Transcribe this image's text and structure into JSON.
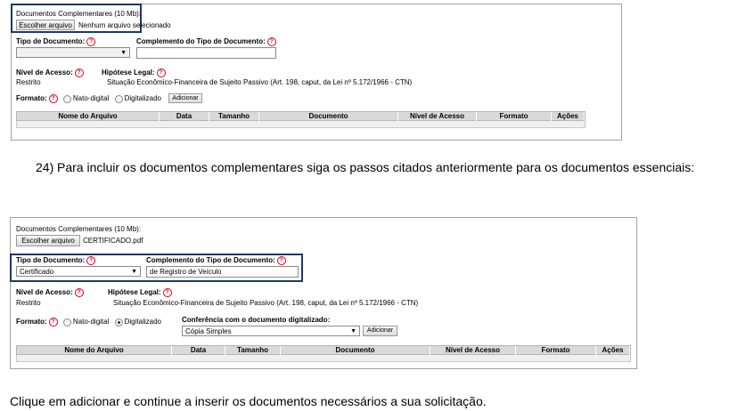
{
  "form1": {
    "section_title": "Documentos Complementares (10 Mb):",
    "choose_button": "Escolher arquivo",
    "file_status": "Nenhum arquivo selecionado",
    "doc_type_label": "Tipo de Documento:",
    "doc_type_value": "",
    "complement_label": "Complemento do Tipo de Documento:",
    "complement_value": "",
    "access_label": "Nível de Acesso:",
    "access_value": "Restrito",
    "legal_label": "Hipótese Legal:",
    "legal_value": "Situação Econômico-Financeira de Sujeito Passivo (Art. 198, caput, da Lei nº 5.172/1966 - CTN)",
    "format_label": "Formato:",
    "format_options": [
      "Nato-digital",
      "Digitalizado"
    ],
    "add_button": "Adicionar",
    "table_headers": [
      "Nome do Arquivo",
      "Data",
      "Tamanho",
      "Documento",
      "Nível de Acesso",
      "Formato",
      "Ações"
    ]
  },
  "instruction_step": {
    "number": "24)",
    "text": "Para incluir os documentos complementares siga os passos citados anteriormente para os documentos essenciais:"
  },
  "form2": {
    "section_title": "Documentos Complementares (10 Mb):",
    "choose_button": "Escolher arquivo",
    "file_status": "CERTIFICADO.pdf",
    "doc_type_label": "Tipo de Documento:",
    "doc_type_value": "Certificado",
    "complement_label": "Complemento do Tipo de Documento:",
    "complement_value": "de Registro de Veículo",
    "access_label": "Nível de Acesso:",
    "access_value": "Restrito",
    "legal_label": "Hipótese Legal:",
    "legal_value": "Situação Econômico-Financeira de Sujeito Passivo (Art. 198, caput, da Lei nº 5.172/1966 - CTN)",
    "format_label": "Formato:",
    "format_options": [
      "Nato-digital",
      "Digitalizado"
    ],
    "conference_label": "Conferência com o documento digitalizado:",
    "conference_value": "Cópia Simples",
    "add_button": "Adicionar",
    "table_headers": [
      "Nome do Arquivo",
      "Data",
      "Tamanho",
      "Documento",
      "Nível de Acesso",
      "Formato",
      "Ações"
    ]
  },
  "footer_text": "Clique em adicionar e continue a inserir os documentos necessários a sua solicitação.",
  "colors": {
    "highlight_border": "#1f3864",
    "help_icon": "#d0021b",
    "table_header_bg": "#d9d9d9"
  }
}
